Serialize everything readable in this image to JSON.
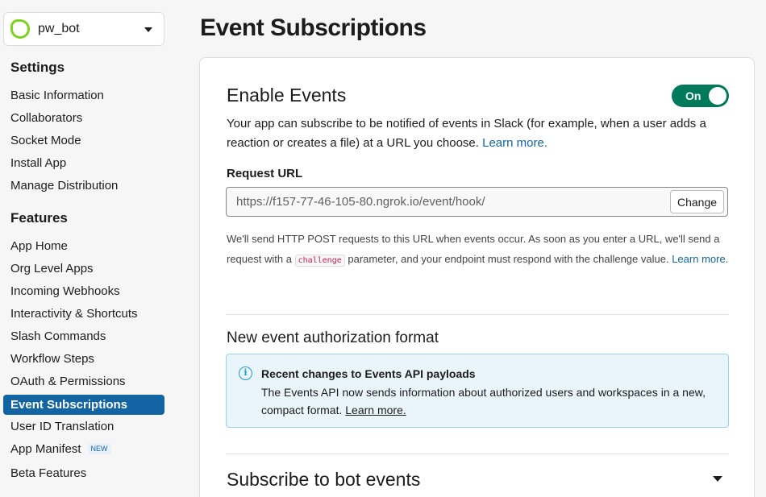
{
  "sidebar": {
    "app_name": "pw_bot",
    "settings_title": "Settings",
    "settings_items": [
      "Basic Information",
      "Collaborators",
      "Socket Mode",
      "Install App",
      "Manage Distribution"
    ],
    "features_title": "Features",
    "features_items": [
      {
        "label": "App Home"
      },
      {
        "label": "Org Level Apps"
      },
      {
        "label": "Incoming Webhooks"
      },
      {
        "label": "Interactivity & Shortcuts"
      },
      {
        "label": "Slash Commands"
      },
      {
        "label": "Workflow Steps"
      },
      {
        "label": "OAuth & Permissions"
      },
      {
        "label": "Event Subscriptions",
        "active": true
      },
      {
        "label": "User ID Translation"
      },
      {
        "label": "App Manifest",
        "badge": "NEW"
      },
      {
        "label": "Beta Features"
      }
    ]
  },
  "main": {
    "page_title": "Event Subscriptions",
    "enable": {
      "title": "Enable Events",
      "toggle_label": "On",
      "description": "Your app can subscribe to be notified of events in Slack (for example, when a user adds a reaction or creates a file) at a URL you choose.",
      "learn_more": "Learn more."
    },
    "request_url": {
      "label": "Request URL",
      "value": "https://f157-77-46-105-80.ngrok.io/event/hook/",
      "change_label": "Change",
      "help_before": "We'll send HTTP POST requests to this URL when events occur. As soon as you enter a URL, we'll send a request with a",
      "help_code": "challenge",
      "help_after": "parameter, and your endpoint must respond with the challenge value.",
      "help_link": "Learn more."
    },
    "auth_format": {
      "title": "New event authorization format",
      "info_title": "Recent changes to Events API payloads",
      "info_body": "The Events API now sends information about authorized users and workspaces in a new, compact format.",
      "info_link": "Learn more."
    },
    "bot_events": {
      "title": "Subscribe to bot events"
    }
  },
  "colors": {
    "accent": "#1264a3",
    "toggle_on": "#007a5a",
    "app_icon": "#7ed321"
  }
}
